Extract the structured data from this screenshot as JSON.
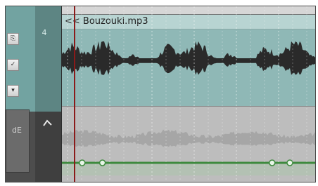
{
  "track": {
    "number": "4",
    "item_name": "<< Bouzouki.mp3",
    "envelope_label": "dE"
  },
  "tcp_buttons": [
    {
      "icon": "fx-button-icon",
      "glyph": "⎘"
    },
    {
      "icon": "route-button-icon",
      "glyph": "✓"
    },
    {
      "icon": "dropdown-icon",
      "glyph": "▾"
    }
  ],
  "colors": {
    "item_bg": "#8fb8b6",
    "waveform": "#2a2a2a",
    "envelope_line": "#3d8a3d",
    "envelope_point": "#e8f5e8",
    "cursor": "#8b1a1a"
  },
  "envelope_points": [
    {
      "pos": 0.08
    },
    {
      "pos": 0.16
    },
    {
      "pos": 0.83
    },
    {
      "pos": 0.9
    }
  ]
}
